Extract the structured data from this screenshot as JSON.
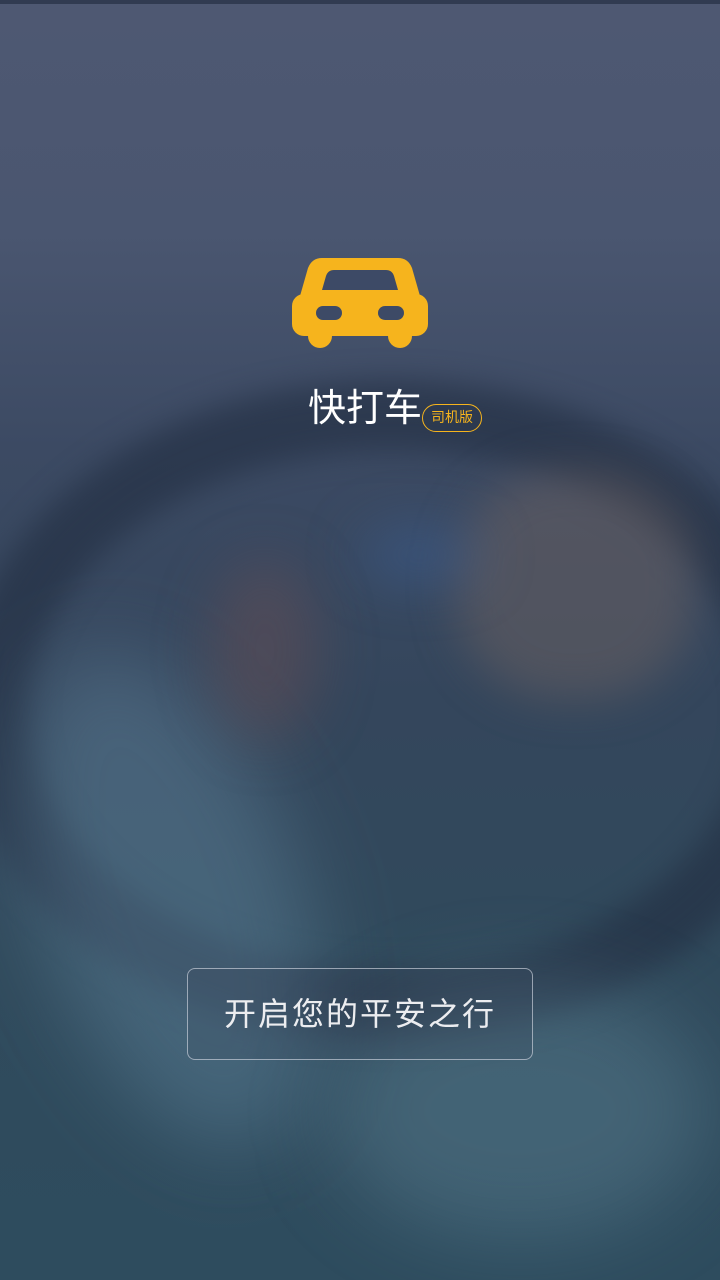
{
  "app": {
    "name": "快打车",
    "edition": "司机版",
    "accent_color": "#f6b41d",
    "logo_icon": "car-icon"
  },
  "cta": {
    "label": "开启您的平安之行"
  },
  "background": {
    "description_colors": [
      "#4e5872",
      "#34465c",
      "#2e4c5e"
    ]
  }
}
